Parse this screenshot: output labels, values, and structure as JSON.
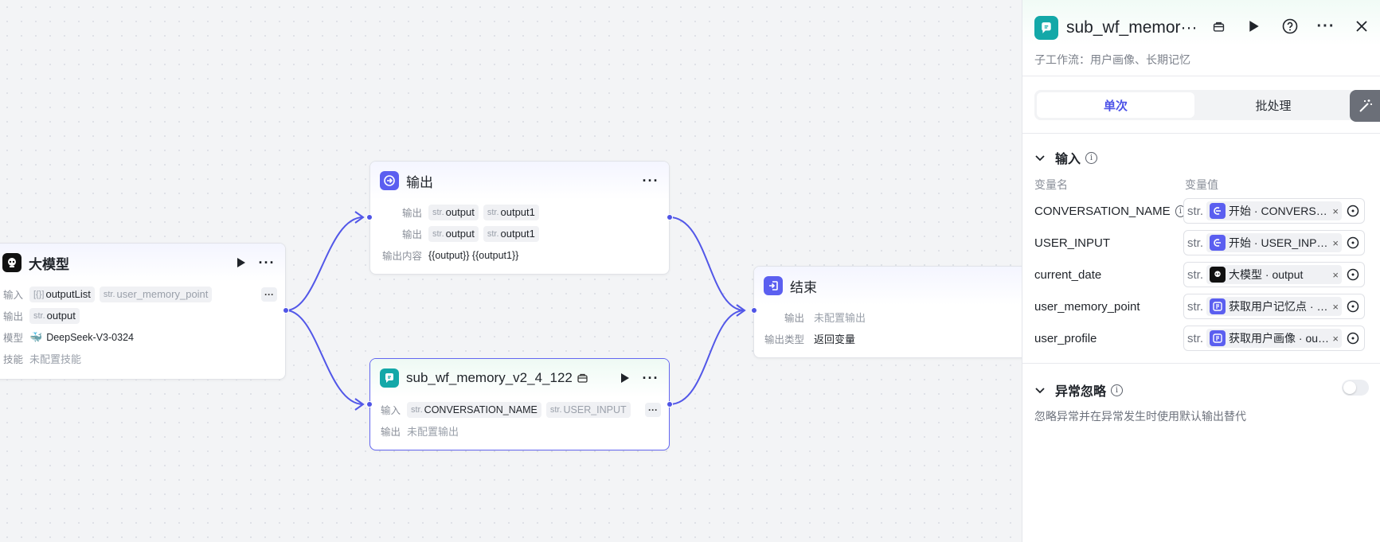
{
  "nodes": {
    "llm": {
      "title": "大模型",
      "rows": [
        {
          "label": "输入",
          "tags": [
            {
              "type": "[{}]",
              "name": "outputList"
            },
            {
              "type": "str.",
              "name": "user_memory_point"
            }
          ],
          "more": "···"
        },
        {
          "label": "输出",
          "tags": [
            {
              "type": "str.",
              "name": "output"
            }
          ]
        },
        {
          "label": "模型",
          "value": "DeepSeek-V3-0324"
        },
        {
          "label": "技能",
          "value": "未配置技能"
        }
      ]
    },
    "output": {
      "title": "输出",
      "rows": [
        {
          "label": "输出",
          "tags": [
            {
              "type": "str.",
              "name": "output"
            },
            {
              "type": "str.",
              "name": "output1"
            }
          ]
        },
        {
          "label": "输出",
          "tags": [
            {
              "type": "str.",
              "name": "output"
            },
            {
              "type": "str.",
              "name": "output1"
            }
          ]
        },
        {
          "label": "输出内容",
          "value": "{{output}} {{output1}}"
        }
      ]
    },
    "subwf": {
      "title": "sub_wf_memory_v2_4_122",
      "rows": [
        {
          "label": "输入",
          "tags": [
            {
              "type": "str.",
              "name": "CONVERSATION_NAME"
            },
            {
              "type": "str.",
              "name": "USER_INPUT"
            }
          ],
          "more": "···"
        },
        {
          "label": "输出",
          "value": "未配置输出"
        }
      ]
    },
    "end": {
      "title": "结束",
      "rows": [
        {
          "label": "输出",
          "value": "未配置输出"
        },
        {
          "label": "输出类型",
          "value": "返回变量"
        }
      ]
    }
  },
  "panel": {
    "title": "sub_wf_memor···",
    "subtitle": "子工作流：用户画像、长期记忆",
    "tabs": [
      "单次",
      "批处理"
    ],
    "active_tab": "单次",
    "input_section": {
      "title": "输入",
      "col_name": "变量名",
      "col_value": "变量值",
      "vars": [
        {
          "name": "CONVERSATION_NAME",
          "has_info": true,
          "type": "str.",
          "ref": "开始 · CONVERSATION_NAME",
          "icon": "start-icon"
        },
        {
          "name": "USER_INPUT",
          "has_info": false,
          "type": "str.",
          "ref": "开始 · USER_INPUT",
          "icon": "start-icon"
        },
        {
          "name": "current_date",
          "has_info": false,
          "type": "str.",
          "ref": "大模型 · output",
          "icon": "llm-icon"
        },
        {
          "name": "user_memory_point",
          "has_info": false,
          "type": "str.",
          "ref": "获取用户记忆点 · output",
          "icon": "plugin-icon"
        },
        {
          "name": "user_profile",
          "has_info": false,
          "type": "str.",
          "ref": "获取用户画像 · output",
          "icon": "plugin-icon"
        }
      ],
      "remove_glyph": "×"
    },
    "exception_section": {
      "title": "异常忽略",
      "description": "忽略异常并在异常发生时使用默认输出替代",
      "enabled": false
    }
  },
  "colors": {
    "accent": "#4d53e8",
    "edge": "#4f54e6",
    "teal": "#13a8a8"
  }
}
